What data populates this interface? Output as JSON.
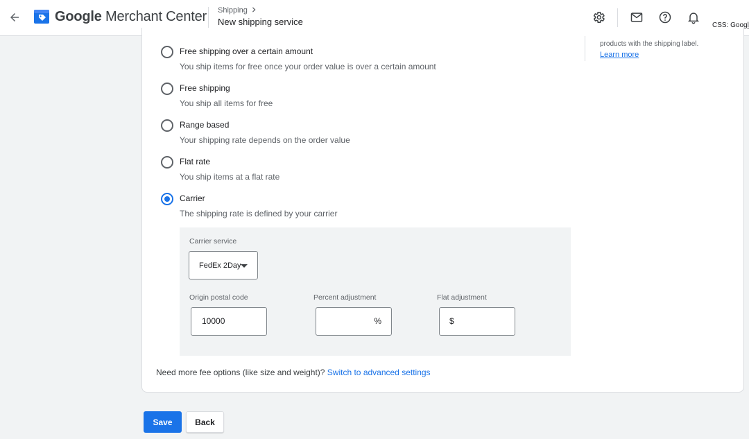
{
  "header": {
    "brand_google": "Google",
    "brand_rest": " Merchant Center",
    "breadcrumb": "Shipping",
    "breadcrumb_icon": "chevron-right-icon",
    "title": "New shipping service",
    "icons": [
      "gear-icon",
      "mail-icon",
      "help-icon",
      "bell-icon"
    ],
    "css_label": "CSS: Googl"
  },
  "side_note": {
    "text": "products with the shipping label.",
    "link": "Learn more"
  },
  "options": [
    {
      "label": "Free shipping over a certain amount",
      "desc": "You ship items for free once your order value is over a certain amount",
      "checked": false
    },
    {
      "label": "Free shipping",
      "desc": "You ship all items for free",
      "checked": false
    },
    {
      "label": "Range based",
      "desc": "Your shipping rate depends on the order value",
      "checked": false
    },
    {
      "label": "Flat rate",
      "desc": "You ship items at a flat rate",
      "checked": false
    },
    {
      "label": "Carrier",
      "desc": "The shipping rate is defined by your carrier",
      "checked": true
    }
  ],
  "carrier": {
    "service_label": "Carrier service",
    "service_value": "FedEx 2Day",
    "origin_label": "Origin postal code",
    "origin_value": "10000",
    "percent_label": "Percent adjustment",
    "percent_value": "",
    "percent_suffix": "%",
    "flat_label": "Flat adjustment",
    "flat_value": "",
    "flat_prefix": "$"
  },
  "more": {
    "text": "Need more fee options (like size and weight)? ",
    "link": "Switch to advanced settings"
  },
  "actions": {
    "save": "Save",
    "back": "Back"
  },
  "colors": {
    "accent": "#1a73e8",
    "background": "#f1f3f4"
  }
}
